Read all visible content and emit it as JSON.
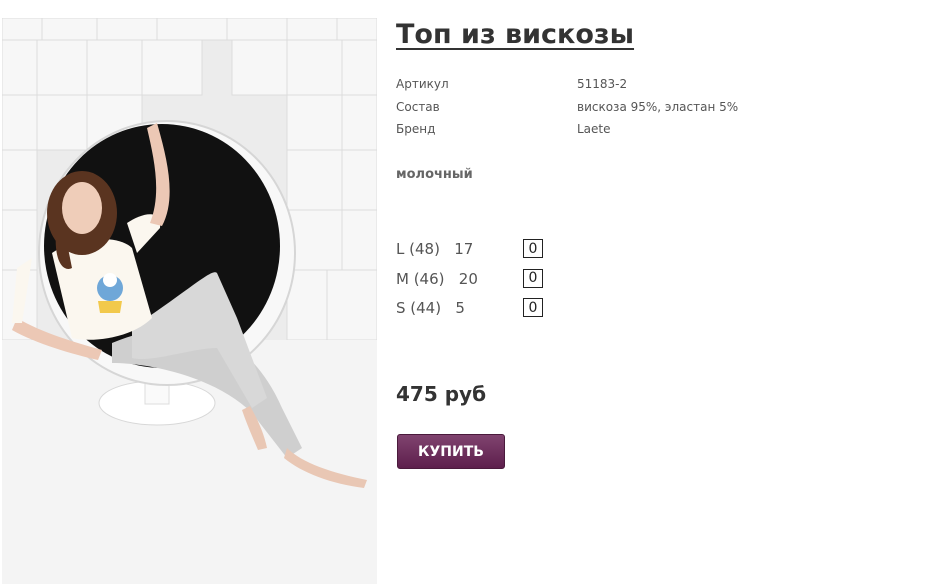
{
  "product": {
    "title": "Топ из вискозы",
    "image_alt": "product-photo",
    "attributes": [
      {
        "key": "Артикул",
        "value": "51183-2"
      },
      {
        "key": "Состав",
        "value": "вискоза 95%, эластан 5%"
      },
      {
        "key": "Бренд",
        "value": "Laete"
      }
    ],
    "color_name": "молочный",
    "sizes": [
      {
        "label": "L (48)   17",
        "qty": "0"
      },
      {
        "label": "M (46)   20",
        "qty": "0"
      },
      {
        "label": "S (44)   5",
        "qty": "0"
      }
    ],
    "price": "475 руб",
    "buy_label": "КУПИТЬ"
  },
  "colors": {
    "buy_button": "#6b2a5a",
    "text": "#333333"
  }
}
